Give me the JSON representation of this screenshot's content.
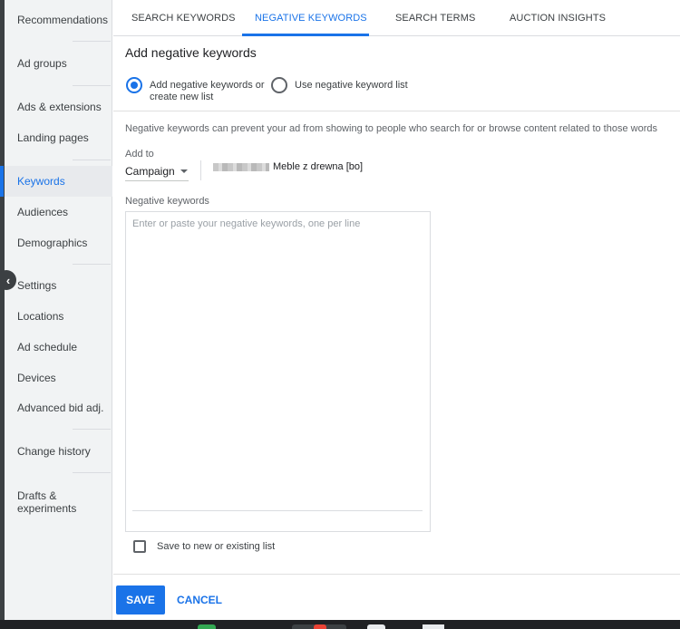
{
  "sidebar": {
    "items": [
      {
        "label": "Recommendations"
      },
      {
        "label": "Ad groups"
      },
      {
        "label": "Ads & extensions"
      },
      {
        "label": "Landing pages"
      },
      {
        "label": "Keywords"
      },
      {
        "label": "Audiences"
      },
      {
        "label": "Demographics"
      },
      {
        "label": "Settings"
      },
      {
        "label": "Locations"
      },
      {
        "label": "Ad schedule"
      },
      {
        "label": "Devices"
      },
      {
        "label": "Advanced bid adj."
      },
      {
        "label": "Change history"
      },
      {
        "label": "Drafts & experiments"
      }
    ],
    "active": "Keywords",
    "collapse_icon": "chevron-left-icon"
  },
  "tabs": [
    {
      "label": "SEARCH KEYWORDS"
    },
    {
      "label": "NEGATIVE KEYWORDS"
    },
    {
      "label": "SEARCH TERMS"
    },
    {
      "label": "AUCTION INSIGHTS"
    }
  ],
  "active_tab": "NEGATIVE KEYWORDS",
  "form": {
    "title": "Add negative keywords",
    "radio_add_new": "Add negative keywords or create new list",
    "radio_use_list": "Use negative keyword list",
    "radio_selected": "add_new",
    "description": "Negative keywords can prevent your ad from showing to people who search for or browse content related to those words",
    "add_to_label": "Add to",
    "add_to_value": "Campaign",
    "campaign_name": "Meble z drewna [bo]",
    "keywords_label": "Negative keywords",
    "keywords_placeholder": "Enter or paste your negative keywords, one per line",
    "keywords_value": "",
    "save_to_list_label": "Save to new or existing list",
    "save_to_list_checked": false
  },
  "actions": {
    "save_label": "SAVE",
    "cancel_label": "CANCEL"
  },
  "colors": {
    "accent": "#1a73e8",
    "sidebar_bg": "#f1f3f4"
  }
}
